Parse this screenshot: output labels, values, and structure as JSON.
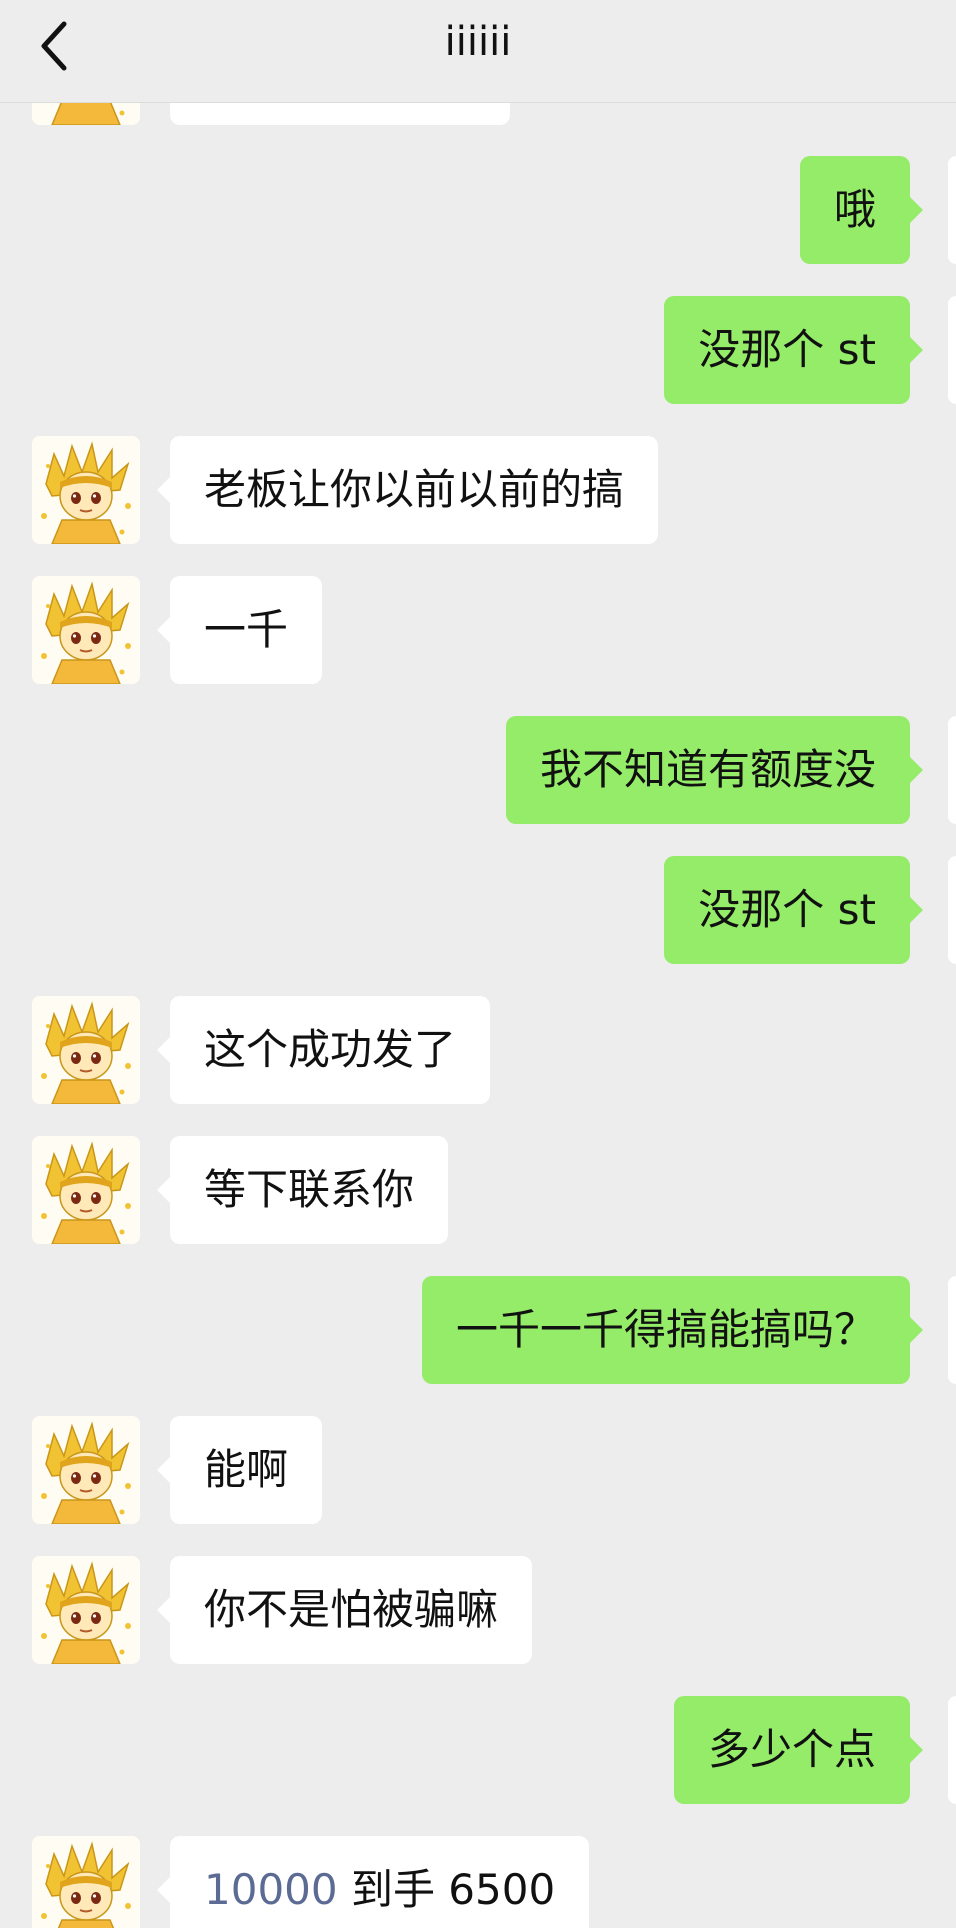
{
  "header": {
    "title": "iiiiii"
  },
  "messages": [
    {
      "side": "left",
      "text": ""
    },
    {
      "side": "right",
      "text": "哦"
    },
    {
      "side": "right",
      "text": "没那个 st"
    },
    {
      "side": "left",
      "text": "老板让你以前以前的搞"
    },
    {
      "side": "left",
      "text": "一千"
    },
    {
      "side": "right",
      "text": "我不知道有额度没"
    },
    {
      "side": "right",
      "text": "没那个 st"
    },
    {
      "side": "left",
      "text": "这个成功发了"
    },
    {
      "side": "left",
      "text": "等下联系你"
    },
    {
      "side": "right",
      "text": "一千一千得搞能搞吗？"
    },
    {
      "side": "left",
      "text": "能啊"
    },
    {
      "side": "left",
      "text": "你不是怕被骗嘛"
    },
    {
      "side": "right",
      "text": "多少个点"
    },
    {
      "side": "left",
      "text_link": "10000",
      "text_rest": " 到手 6500"
    }
  ]
}
